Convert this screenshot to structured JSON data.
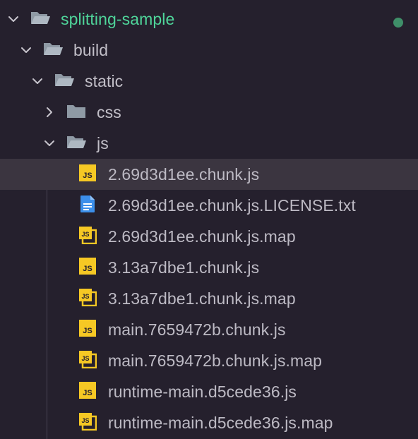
{
  "theme": {
    "background": "#25202d",
    "selected_row": "#3b3540",
    "root_label_color": "#4fd59a",
    "status_dot_color": "#3f8f69",
    "js_icon_color": "#f6c824",
    "txt_icon_color": "#3c8fea",
    "folder_icon_color": "#8f9aa5"
  },
  "tree": {
    "root": {
      "label": "splitting-sample",
      "expanded": true,
      "status_dot": "green-dot-icon"
    },
    "folders": [
      {
        "label": "build",
        "expanded": true
      },
      {
        "label": "static",
        "expanded": true
      },
      {
        "label": "css",
        "expanded": false
      },
      {
        "label": "js",
        "expanded": true
      }
    ],
    "files": [
      {
        "label": "2.69d3d1ee.chunk.js",
        "icon": "javascript-file-icon",
        "selected": true
      },
      {
        "label": "2.69d3d1ee.chunk.js.LICENSE.txt",
        "icon": "text-file-icon",
        "selected": false
      },
      {
        "label": "2.69d3d1ee.chunk.js.map",
        "icon": "javascript-map-file-icon",
        "selected": false
      },
      {
        "label": "3.13a7dbe1.chunk.js",
        "icon": "javascript-file-icon",
        "selected": false
      },
      {
        "label": "3.13a7dbe1.chunk.js.map",
        "icon": "javascript-map-file-icon",
        "selected": false
      },
      {
        "label": "main.7659472b.chunk.js",
        "icon": "javascript-file-icon",
        "selected": false
      },
      {
        "label": "main.7659472b.chunk.js.map",
        "icon": "javascript-map-file-icon",
        "selected": false
      },
      {
        "label": "runtime-main.d5cede36.js",
        "icon": "javascript-file-icon",
        "selected": false
      },
      {
        "label": "runtime-main.d5cede36.js.map",
        "icon": "javascript-map-file-icon",
        "selected": false
      }
    ]
  }
}
